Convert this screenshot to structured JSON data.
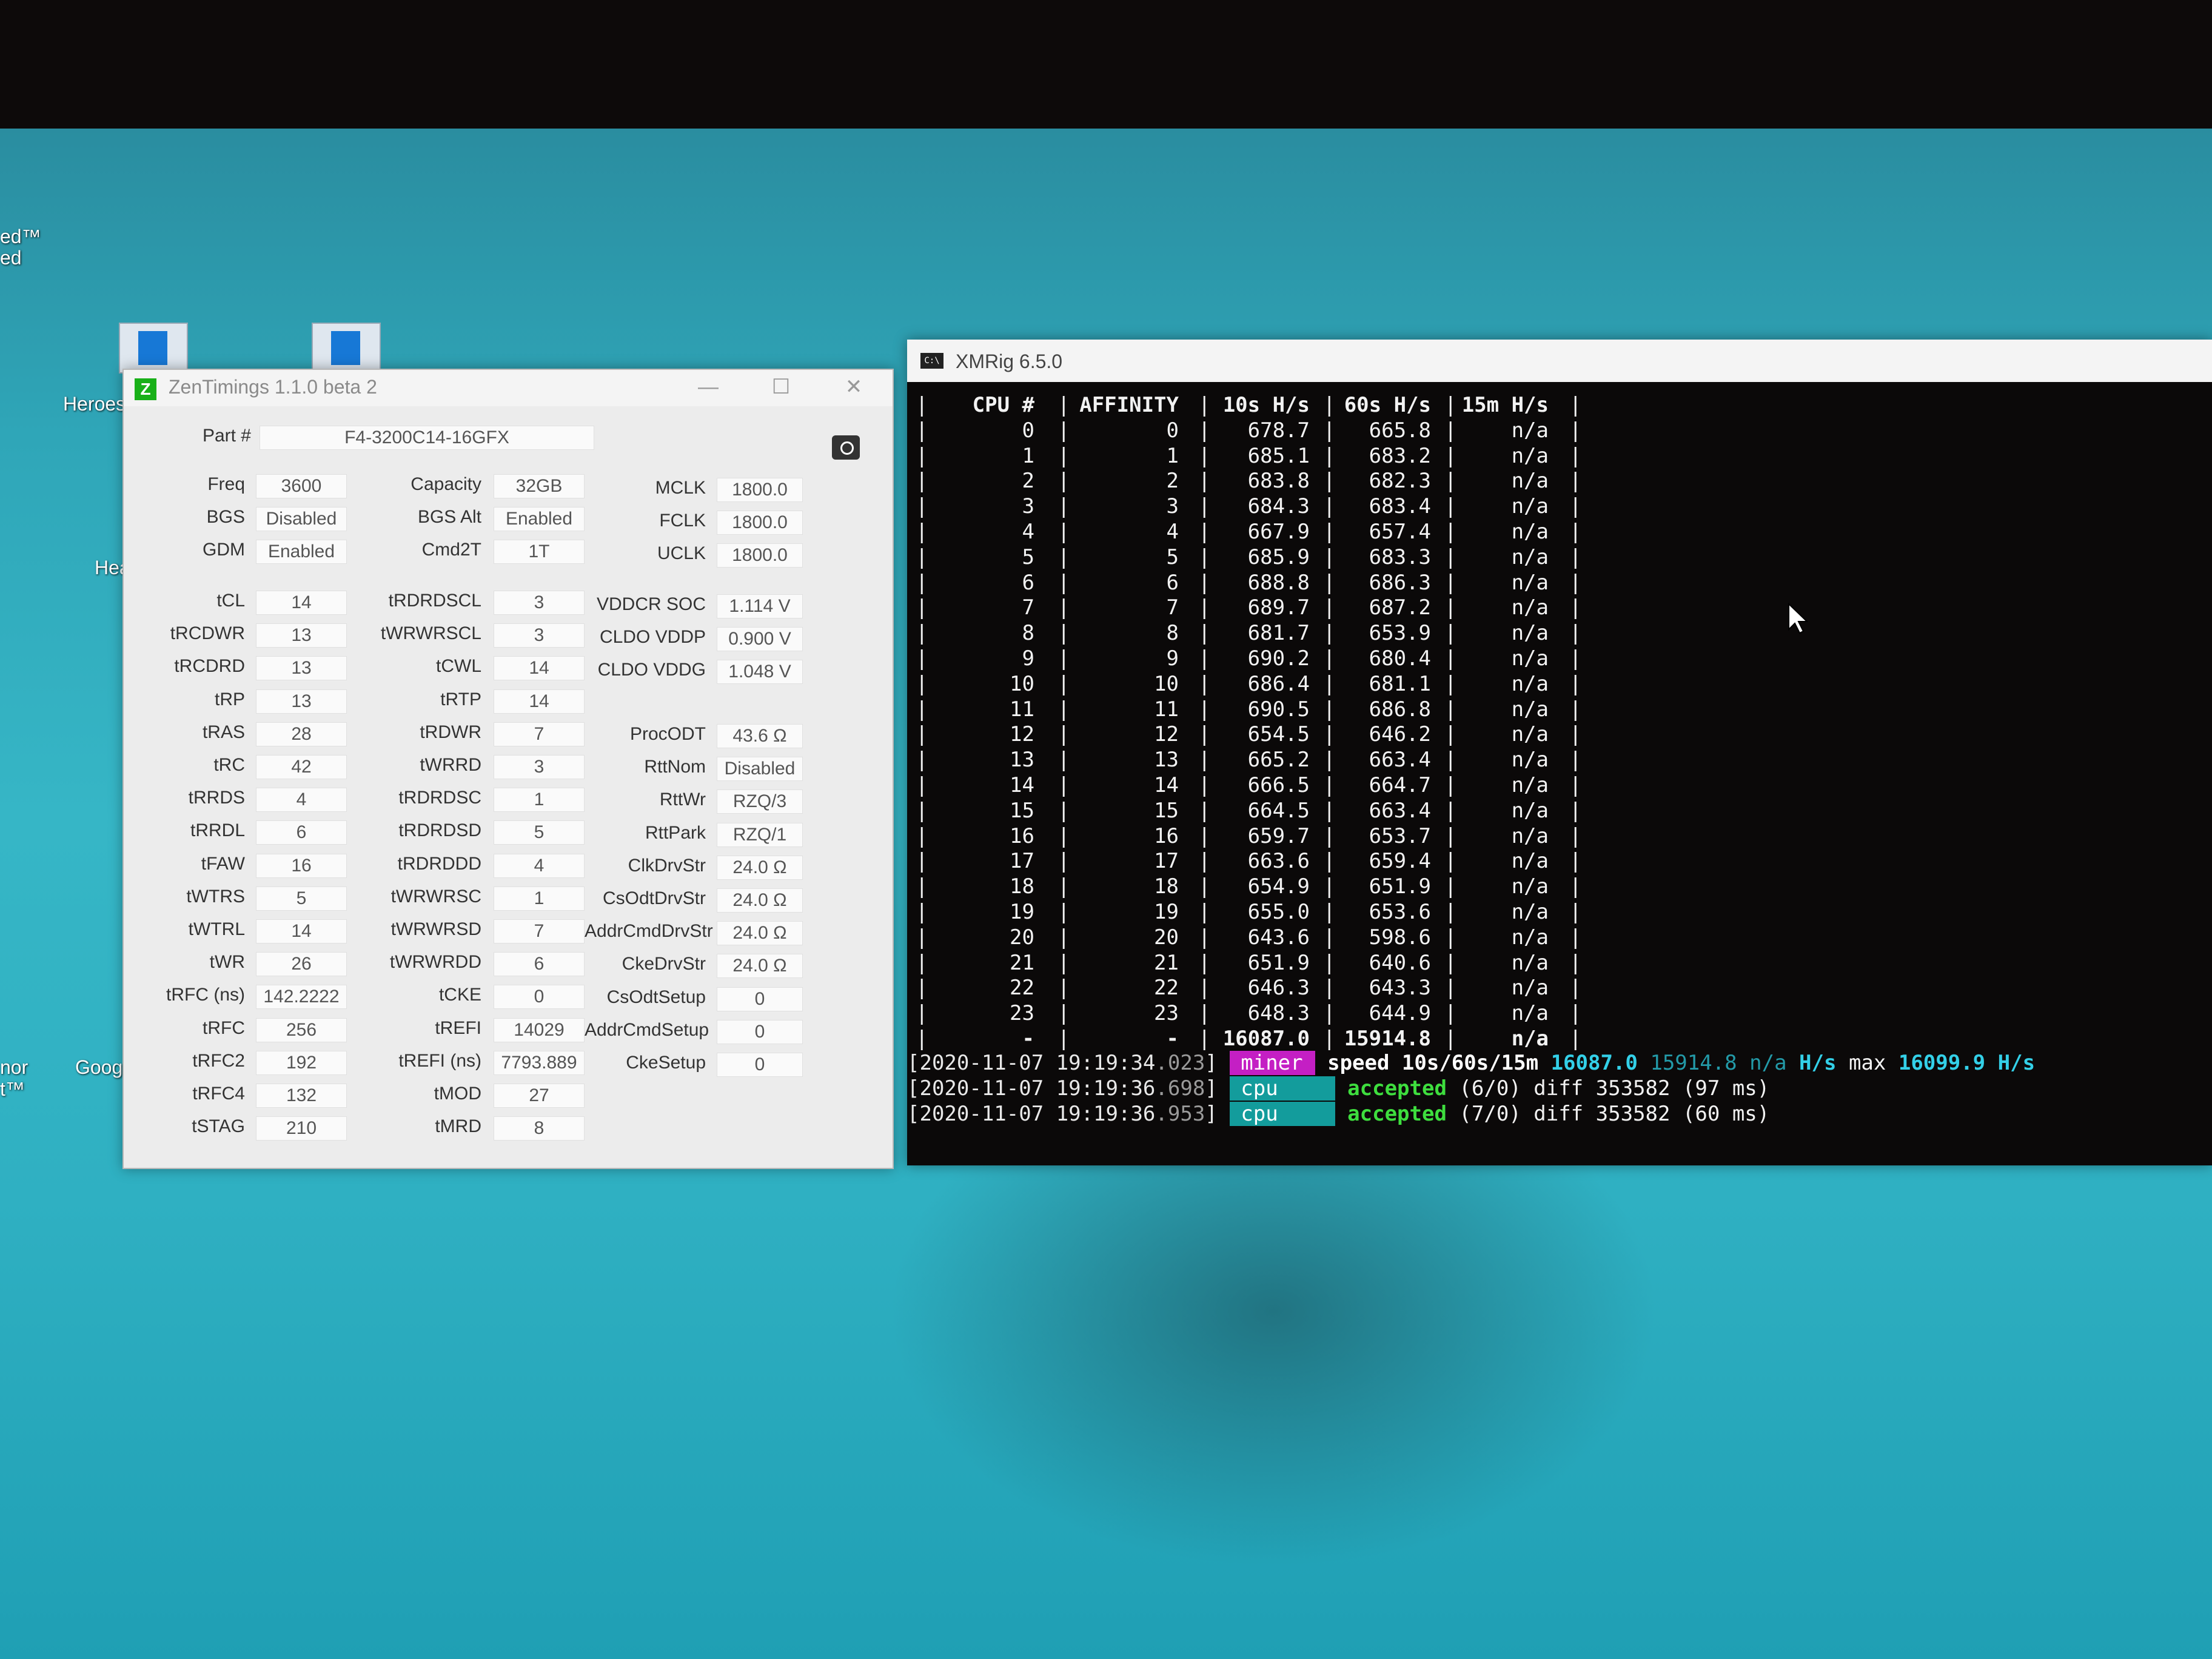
{
  "desktop": {
    "left_text_1": "ed™",
    "left_text_2": "ed",
    "icon_label_1": "Heroes",
    "icon_label_2": "Hea",
    "icon_label_3": "Goog",
    "left_text_3": "nor",
    "left_text_4": "t™"
  },
  "zentimings": {
    "title": "ZenTimings 1.1.0 beta 2",
    "part_label": "Part #",
    "part_value": "F4-3200C14-16GFX",
    "col1": [
      {
        "label": "Freq",
        "value": "3600"
      },
      {
        "label": "BGS",
        "value": "Disabled"
      },
      {
        "label": "GDM",
        "value": "Enabled"
      },
      {
        "label": "tCL",
        "value": "14"
      },
      {
        "label": "tRCDWR",
        "value": "13"
      },
      {
        "label": "tRCDRD",
        "value": "13"
      },
      {
        "label": "tRP",
        "value": "13"
      },
      {
        "label": "tRAS",
        "value": "28"
      },
      {
        "label": "tRC",
        "value": "42"
      },
      {
        "label": "tRRDS",
        "value": "4"
      },
      {
        "label": "tRRDL",
        "value": "6"
      },
      {
        "label": "tFAW",
        "value": "16"
      },
      {
        "label": "tWTRS",
        "value": "5"
      },
      {
        "label": "tWTRL",
        "value": "14"
      },
      {
        "label": "tWR",
        "value": "26"
      },
      {
        "label": "tRFC (ns)",
        "value": "142.2222"
      },
      {
        "label": "tRFC",
        "value": "256"
      },
      {
        "label": "tRFC2",
        "value": "192"
      },
      {
        "label": "tRFC4",
        "value": "132"
      },
      {
        "label": "tSTAG",
        "value": "210"
      }
    ],
    "col2": [
      {
        "label": "Capacity",
        "value": "32GB"
      },
      {
        "label": "BGS Alt",
        "value": "Enabled"
      },
      {
        "label": "Cmd2T",
        "value": "1T"
      },
      {
        "label": "tRDRDSCL",
        "value": "3"
      },
      {
        "label": "tWRWRSCL",
        "value": "3"
      },
      {
        "label": "tCWL",
        "value": "14"
      },
      {
        "label": "tRTP",
        "value": "14"
      },
      {
        "label": "tRDWR",
        "value": "7"
      },
      {
        "label": "tWRRD",
        "value": "3"
      },
      {
        "label": "tRDRDSC",
        "value": "1"
      },
      {
        "label": "tRDRDSD",
        "value": "5"
      },
      {
        "label": "tRDRDDD",
        "value": "4"
      },
      {
        "label": "tWRWRSC",
        "value": "1"
      },
      {
        "label": "tWRWRSD",
        "value": "7"
      },
      {
        "label": "tWRWRDD",
        "value": "6"
      },
      {
        "label": "tCKE",
        "value": "0"
      },
      {
        "label": "tREFI",
        "value": "14029"
      },
      {
        "label": "tREFI (ns)",
        "value": "7793.889"
      },
      {
        "label": "tMOD",
        "value": "27"
      },
      {
        "label": "tMRD",
        "value": "8"
      }
    ],
    "col3": [
      {
        "label": "MCLK",
        "value": "1800.0"
      },
      {
        "label": "FCLK",
        "value": "1800.0"
      },
      {
        "label": "UCLK",
        "value": "1800.0"
      },
      {
        "label": "VDDCR SOC",
        "value": "1.114 V"
      },
      {
        "label": "CLDO VDDP",
        "value": "0.900 V"
      },
      {
        "label": "CLDO VDDG",
        "value": "1.048 V"
      },
      {
        "label": "ProcODT",
        "value": "43.6 Ω"
      },
      {
        "label": "RttNom",
        "value": "Disabled"
      },
      {
        "label": "RttWr",
        "value": "RZQ/3"
      },
      {
        "label": "RttPark",
        "value": "RZQ/1"
      },
      {
        "label": "ClkDrvStr",
        "value": "24.0 Ω"
      },
      {
        "label": "CsOdtDrvStr",
        "value": "24.0 Ω"
      },
      {
        "label": "AddrCmdDrvStr",
        "value": "24.0 Ω"
      },
      {
        "label": "CkeDrvStr",
        "value": "24.0 Ω"
      },
      {
        "label": "CsOdtSetup",
        "value": "0"
      },
      {
        "label": "AddrCmdSetup",
        "value": "0"
      },
      {
        "label": "CkeSetup",
        "value": "0"
      }
    ]
  },
  "xmrig": {
    "title": "XMRig 6.5.0",
    "headers": [
      "CPU #",
      "AFFINITY",
      "10s H/s",
      "60s H/s",
      "15m H/s"
    ],
    "rows": [
      [
        "0",
        "0",
        "678.7",
        "665.8",
        "n/a"
      ],
      [
        "1",
        "1",
        "685.1",
        "683.2",
        "n/a"
      ],
      [
        "2",
        "2",
        "683.8",
        "682.3",
        "n/a"
      ],
      [
        "3",
        "3",
        "684.3",
        "683.4",
        "n/a"
      ],
      [
        "4",
        "4",
        "667.9",
        "657.4",
        "n/a"
      ],
      [
        "5",
        "5",
        "685.9",
        "683.3",
        "n/a"
      ],
      [
        "6",
        "6",
        "688.8",
        "686.3",
        "n/a"
      ],
      [
        "7",
        "7",
        "689.7",
        "687.2",
        "n/a"
      ],
      [
        "8",
        "8",
        "681.7",
        "653.9",
        "n/a"
      ],
      [
        "9",
        "9",
        "690.2",
        "680.4",
        "n/a"
      ],
      [
        "10",
        "10",
        "686.4",
        "681.1",
        "n/a"
      ],
      [
        "11",
        "11",
        "690.5",
        "686.8",
        "n/a"
      ],
      [
        "12",
        "12",
        "654.5",
        "646.2",
        "n/a"
      ],
      [
        "13",
        "13",
        "665.2",
        "663.4",
        "n/a"
      ],
      [
        "14",
        "14",
        "666.5",
        "664.7",
        "n/a"
      ],
      [
        "15",
        "15",
        "664.5",
        "663.4",
        "n/a"
      ],
      [
        "16",
        "16",
        "659.7",
        "653.7",
        "n/a"
      ],
      [
        "17",
        "17",
        "663.6",
        "659.4",
        "n/a"
      ],
      [
        "18",
        "18",
        "654.9",
        "651.9",
        "n/a"
      ],
      [
        "19",
        "19",
        "655.0",
        "653.6",
        "n/a"
      ],
      [
        "20",
        "20",
        "643.6",
        "598.6",
        "n/a"
      ],
      [
        "21",
        "21",
        "651.9",
        "640.6",
        "n/a"
      ],
      [
        "22",
        "22",
        "646.3",
        "643.3",
        "n/a"
      ],
      [
        "23",
        "23",
        "648.3",
        "644.9",
        "n/a"
      ],
      [
        "-",
        "-",
        "16087.0",
        "15914.8",
        "n/a"
      ]
    ],
    "log": [
      {
        "ts_main": "[2020-11-07 19:19:34",
        "ts_ms": ".023",
        "tag": "miner",
        "msg_a": "speed 10s/60s/15m",
        "v1": "16087.0",
        "v2": "15914.8",
        "v3": "n/a",
        "unit": "H/s",
        "max_label": "max",
        "max_value": "16099.9",
        "max_unit": "H/s"
      },
      {
        "ts_main": "[2020-11-07 19:19:36",
        "ts_ms": ".698",
        "tag": "cpu",
        "status": "accepted",
        "counts": "(6/0)",
        "diff_label": "diff",
        "diff_value": "353582",
        "ms": "(97 ms)"
      },
      {
        "ts_main": "[2020-11-07 19:19:36",
        "ts_ms": ".953",
        "tag": "cpu",
        "status": "accepted",
        "counts": "(7/0)",
        "diff_label": "diff",
        "diff_value": "353582",
        "ms": "(60 ms)"
      }
    ]
  }
}
